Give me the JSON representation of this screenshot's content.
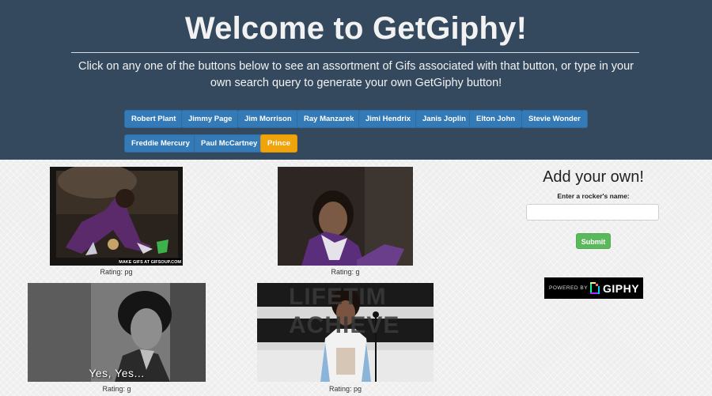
{
  "header": {
    "title": "Welcome to GetGiphy!",
    "subtitle": "Click on any one of the buttons below to see an assortment of Gifs associated with that button, or type in your own search query to generate your own GetGiphy button!"
  },
  "buttons": [
    {
      "label": "Robert Plant"
    },
    {
      "label": "Jimmy Page"
    },
    {
      "label": "Jim Morrison"
    },
    {
      "label": "Ray Manzarek"
    },
    {
      "label": "Jimi Hendrix"
    },
    {
      "label": "Janis Joplin"
    },
    {
      "label": "Elton John"
    },
    {
      "label": "Stevie Wonder"
    },
    {
      "label": "Freddie Mercury"
    },
    {
      "label": "Paul McCartney"
    },
    {
      "label": "Prince",
      "active": true
    }
  ],
  "gifs": [
    {
      "rating": "Rating: pg",
      "watermark": "MAKE GIFS AT GIFSOUP.COM"
    },
    {
      "rating": "Rating: g"
    },
    {
      "rating": "Rating: g",
      "caption": "Yes, Yes..."
    },
    {
      "rating": "Rating: pg",
      "sign_text": "LIFETIM ACHIEVE"
    }
  ],
  "sidebar": {
    "title": "Add your own!",
    "input_label": "Enter a rocker's name:",
    "input_value": "",
    "input_placeholder": "",
    "submit_label": "Submit",
    "badge_powered": "POWERED BY",
    "badge_brand": "GIPHY"
  },
  "colors": {
    "header_bg": "#34495e",
    "button_blue": "#337ab7",
    "button_active": "#f0a30a",
    "submit_green": "#5cb85c"
  }
}
